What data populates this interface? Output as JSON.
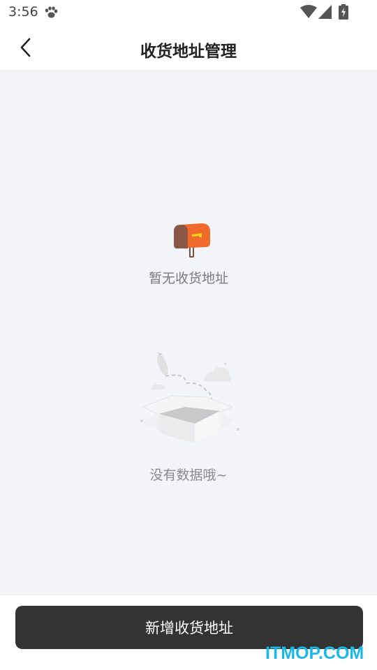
{
  "status_bar": {
    "time": "3:56"
  },
  "header": {
    "title": "收货地址管理"
  },
  "empty_state": {
    "no_address_text": "暂无收货地址",
    "no_data_text": "没有数据哦~"
  },
  "footer": {
    "add_button_label": "新增收货地址"
  },
  "watermark": "ITMOP.COM",
  "colors": {
    "background": "#f3f4f8",
    "button": "#333333",
    "mailbox_accent": "#f06a2b",
    "watermark": "#1ab8e8"
  }
}
